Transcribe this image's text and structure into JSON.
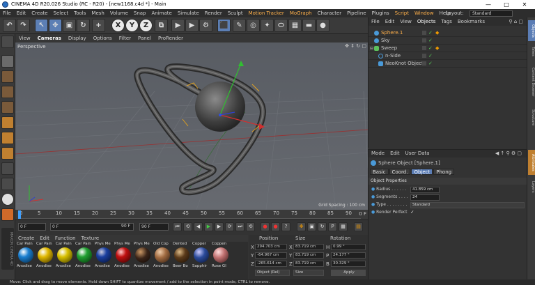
{
  "window": {
    "title": "CINEMA 4D R20.026 Studio (RC - R20) - [new1168.c4d *] - Main",
    "controls": [
      "—",
      "□",
      "✕"
    ]
  },
  "menubar": {
    "items": [
      "File",
      "Edit",
      "Create",
      "Select",
      "Tools",
      "Mesh",
      "Volume",
      "Snap",
      "Animate",
      "Simulate",
      "Render",
      "Sculpt",
      "Motion Tracker",
      "MoGraph",
      "Character",
      "Pipeline",
      "Plugins",
      "Script",
      "Window",
      "Help"
    ],
    "layout_label": "Layout:",
    "layout_value": "Standard"
  },
  "toolbar": {
    "x_label": "X",
    "y_label": "Y",
    "z_label": "Z"
  },
  "viewport": {
    "menu": [
      "View",
      "Cameras",
      "Display",
      "Options",
      "Filter",
      "Panel",
      "ProRender"
    ],
    "camera_label": "Perspective",
    "grid_spacing": "Grid Spacing : 100 cm"
  },
  "timeline": {
    "ticks": [
      "0",
      "5",
      "10",
      "15",
      "20",
      "25",
      "30",
      "35",
      "40",
      "45",
      "50",
      "55",
      "60",
      "65",
      "70",
      "75",
      "80",
      "85",
      "90"
    ],
    "frame_marker": "0 F"
  },
  "playback": {
    "start": "0 F",
    "current": "0 F",
    "end": "90 F",
    "end2": "90 F"
  },
  "materials": {
    "menu": [
      "Create",
      "Edit",
      "Function",
      "Texture"
    ],
    "items": [
      {
        "top": "Car Pain",
        "bottom": "Anodise",
        "color": "#1a7fd0"
      },
      {
        "top": "Car Pain",
        "bottom": "Anodise",
        "color": "#e0b800"
      },
      {
        "top": "Car Pain",
        "bottom": "Anodise",
        "color": "#d8c000"
      },
      {
        "top": "Car Pain",
        "bottom": "Anodise",
        "color": "#20a030"
      },
      {
        "top": "Phys Me",
        "bottom": "Anodise",
        "color": "#1a3fa0"
      },
      {
        "top": "Phys Me",
        "bottom": "Anodise",
        "color": "#c01010"
      },
      {
        "top": "Phys Me",
        "bottom": "Anodise",
        "color": "#3a2418"
      },
      {
        "top": "Old Cop",
        "bottom": "Anodise",
        "color": "#a06a40"
      },
      {
        "top": "Dented",
        "bottom": "Beer Bo",
        "color": "#5a3a1a"
      },
      {
        "top": "Copper",
        "bottom": "Sapphir",
        "color": "#2a4a9a"
      },
      {
        "top": "Coppen",
        "bottom": "Rose Gl",
        "color": "#c07070"
      }
    ]
  },
  "coords": {
    "headers": [
      "Position",
      "Size",
      "Rotation"
    ],
    "rows": [
      {
        "axis": "X",
        "pos": "294.703 cm",
        "size_axis": "X",
        "size": "83.719 cm",
        "rot_axis": "H",
        "rot": "0.99 °"
      },
      {
        "axis": "Y",
        "pos": "-64.967 cm",
        "size_axis": "Y",
        "size": "83.719 cm",
        "rot_axis": "P",
        "rot": "24.177 °"
      },
      {
        "axis": "Z",
        "pos": "-265.614 cm",
        "size_axis": "Z",
        "size": "83.719 cm",
        "rot_axis": "B",
        "rot": "30.329 °"
      }
    ],
    "mode": "Object (Rel)",
    "size_mode": "Size",
    "apply": "Apply"
  },
  "objects": {
    "menu": [
      "File",
      "Edit",
      "View",
      "Objects",
      "Tags",
      "Bookmarks"
    ],
    "rows": [
      {
        "name": "Sphere.1",
        "color": "#ffb04a",
        "icon": "#4a9ad8",
        "indent": 0
      },
      {
        "name": "Sky",
        "color": "#d0d0d0",
        "icon": "#4a9ad8",
        "indent": 0
      },
      {
        "name": "Sweep",
        "color": "#d0d0d0",
        "icon": "#5cc05c",
        "indent": 0
      },
      {
        "name": "n-Side",
        "color": "#d0d0d0",
        "icon": "#4a9ad8",
        "indent": 1
      },
      {
        "name": "NeoKnot Object",
        "color": "#d0d0d0",
        "icon": "#4a9ad8",
        "indent": 1
      }
    ]
  },
  "attributes": {
    "menu": [
      "Mode",
      "Edit",
      "User Data"
    ],
    "object_title": "Sphere Object [Sphere.1]",
    "tabs": [
      "Basic",
      "Coord.",
      "Object",
      "Phong"
    ],
    "section": "Object Properties",
    "props": [
      {
        "label": "Radius . . . . . .",
        "value": "41.859 cm"
      },
      {
        "label": "Segments . . . .",
        "value": "24"
      },
      {
        "label": "Type . . . . . . . .",
        "value": "Standard"
      },
      {
        "label": "Render Perfect",
        "value": "✓"
      }
    ]
  },
  "sidetabs": [
    "Objects",
    "Takes",
    "Content Browser",
    "Structure",
    "Attributes",
    "Layers"
  ],
  "status": "Move: Click and drag to move elements. Hold down SHIFT to quantize movement / add to the selection in point mode, CTRL to remove."
}
